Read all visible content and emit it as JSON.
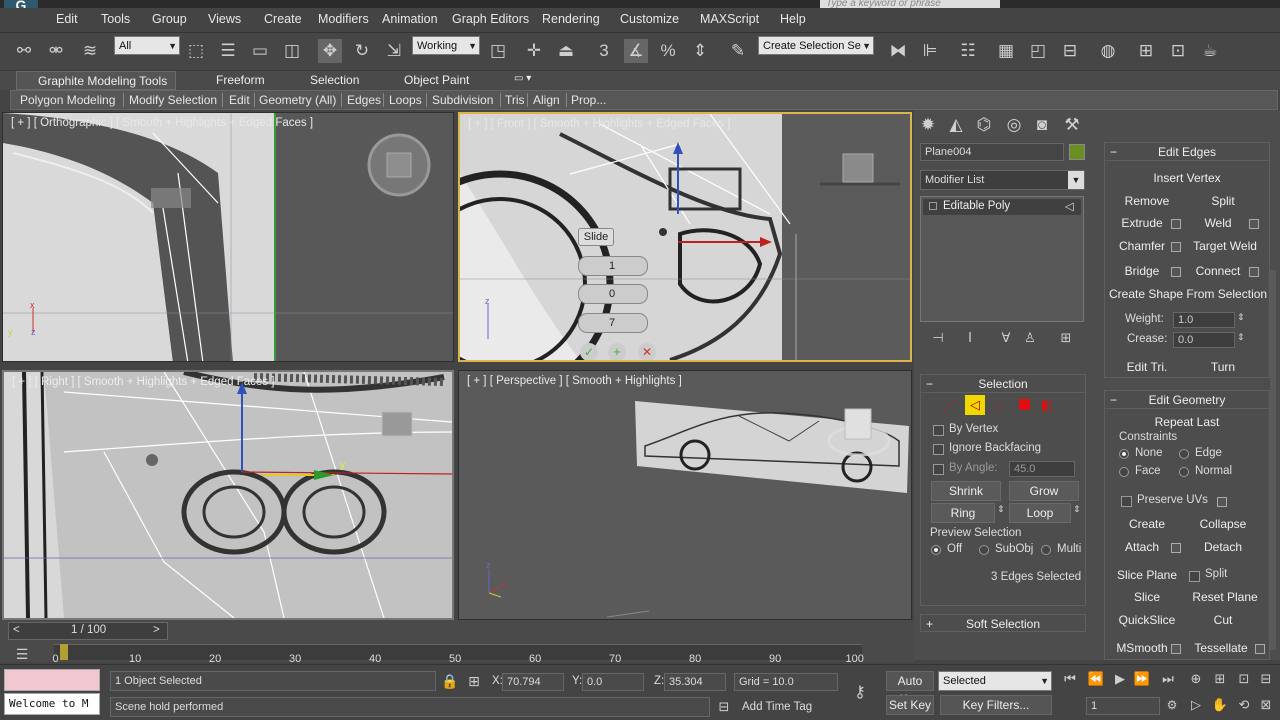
{
  "app": {
    "logo_glyph": "G"
  },
  "search": {
    "placeholder": "Type a keyword or phrase"
  },
  "menu": [
    "Edit",
    "Tools",
    "Group",
    "Views",
    "Create",
    "Modifiers",
    "Animation",
    "Graph Editors",
    "Rendering",
    "Customize",
    "MAXScript",
    "Help"
  ],
  "toolbar": {
    "filter_value": "All",
    "refcoord_value": "Working",
    "snap_label": "3",
    "selection_set_value": "Create Selection Se"
  },
  "ribbon": {
    "tabs": [
      "Graphite Modeling Tools",
      "Freeform",
      "Selection",
      "Object Paint"
    ],
    "panels": [
      "Polygon Modeling",
      "Modify Selection",
      "Edit",
      "Geometry (All)",
      "Edges",
      "Loops",
      "Subdivision",
      "Tris",
      "Align",
      "Prop..."
    ]
  },
  "viewports": {
    "top_left_label": "[ + ] [ Orthographic ] [ Smooth + Highlights + Edged Faces ]",
    "top_right_label": "[ + ] [ Front ] [ Smooth + Highlights + Edged Faces ]",
    "bottom_left_label": "[ + ] [ Right ] [ Smooth + Highlights + Edged Faces ]",
    "bottom_right_label": "[ + ] [ Perspective ] [ Smooth + Highlights ]",
    "caddy": {
      "title": "Slide",
      "field1": "1",
      "field2": "0",
      "field3": "7"
    }
  },
  "command_panel": {
    "object_name": "Plane004",
    "object_color": "#6b8e23",
    "modifier_list_label": "Modifier List",
    "stack_item": "Editable Poly",
    "selection": {
      "title": "Selection",
      "by_vertex": "By Vertex",
      "ignore_backfacing": "Ignore Backfacing",
      "by_angle": "By Angle:",
      "by_angle_value": "45.0",
      "shrink": "Shrink",
      "grow": "Grow",
      "ring": "Ring",
      "loop": "Loop",
      "preview_selection": "Preview Selection",
      "preview_off": "Off",
      "preview_subobj": "SubObj",
      "preview_multi": "Multi",
      "status": "3 Edges Selected"
    },
    "soft_selection": "Soft Selection",
    "edit_edges": {
      "title": "Edit Edges",
      "insert_vertex": "Insert Vertex",
      "remove": "Remove",
      "split": "Split",
      "extrude": "Extrude",
      "weld": "Weld",
      "chamfer": "Chamfer",
      "target_weld": "Target Weld",
      "bridge": "Bridge",
      "connect": "Connect",
      "create_shape": "Create Shape From Selection",
      "weight_label": "Weight:",
      "weight_value": "1.0",
      "crease_label": "Crease:",
      "crease_value": "0.0",
      "edit_tri": "Edit Tri.",
      "turn": "Turn"
    },
    "edit_geometry": {
      "title": "Edit Geometry",
      "repeat_last": "Repeat Last",
      "constraints": "Constraints",
      "none": "None",
      "edge": "Edge",
      "face": "Face",
      "normal": "Normal",
      "preserve_uvs": "Preserve UVs",
      "create": "Create",
      "collapse": "Collapse",
      "attach": "Attach",
      "detach": "Detach",
      "slice_plane": "Slice Plane",
      "split": "Split",
      "slice": "Slice",
      "reset_plane": "Reset Plane",
      "quickslice": "QuickSlice",
      "cut": "Cut",
      "msmooth": "MSmooth",
      "tessellate": "Tessellate"
    }
  },
  "timeline": {
    "frame_label": "1 / 100",
    "ticks": [
      "0",
      "10",
      "20",
      "30",
      "40",
      "50",
      "60",
      "70",
      "80",
      "90",
      "100"
    ]
  },
  "status": {
    "selected_objects": "1 Object Selected",
    "prompt": "Scene hold performed",
    "listener": "Welcome to M",
    "x_label": "X:",
    "x_value": "70.794",
    "y_label": "Y:",
    "y_value": "0.0",
    "z_label": "Z:",
    "z_value": "35.304",
    "grid": "Grid = 10.0",
    "add_time_tag": "Add Time Tag",
    "auto_key": "Auto Key",
    "set_key": "Set Key",
    "key_mode_value": "Selected",
    "key_filters": "Key Filters...",
    "current_frame": "1"
  }
}
